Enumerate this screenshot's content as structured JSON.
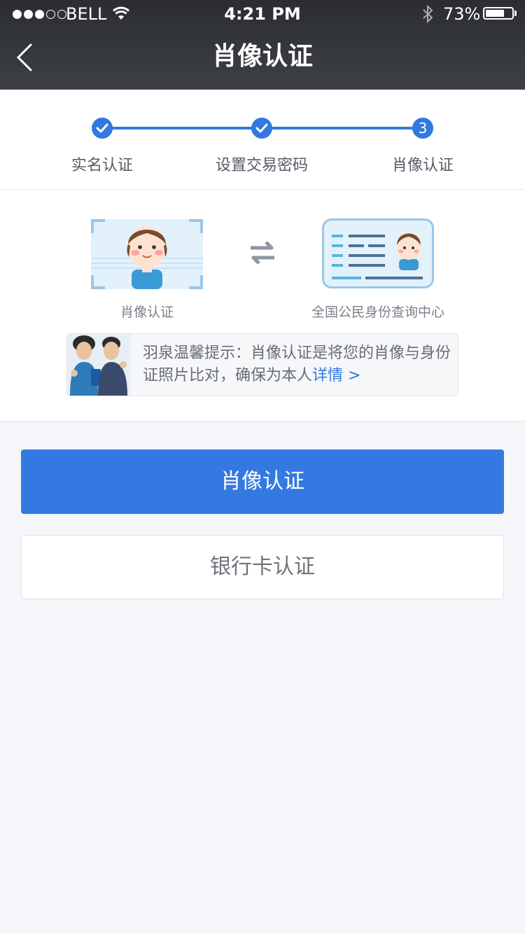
{
  "status_bar": {
    "carrier": "BELL",
    "time": "4:21 PM",
    "battery": "73%",
    "battery_level": 0.73,
    "signal_bars_filled": 3,
    "signal_bars_total": 5
  },
  "nav": {
    "title": "肖像认证",
    "back_icon": "chevron-left-icon"
  },
  "steps": [
    {
      "label": "实名认证",
      "state": "done"
    },
    {
      "label": "设置交易密码",
      "state": "done"
    },
    {
      "label": "肖像认证",
      "state": "current",
      "number": "3"
    }
  ],
  "compare": {
    "left_label": "肖像认证",
    "right_label": "全国公民身份查询中心",
    "swap_icon": "swap-arrows-icon"
  },
  "tip": {
    "text": "羽泉温馨提示：肖像认证是将您的肖像与身份证照片比对，确保为本人",
    "link": "详情 >"
  },
  "buttons": {
    "primary": "肖像认证",
    "secondary": "银行卡认证"
  },
  "colors": {
    "accent": "#3378e0",
    "header_bg": "#34373c",
    "page_bg": "#f5f6fa"
  }
}
